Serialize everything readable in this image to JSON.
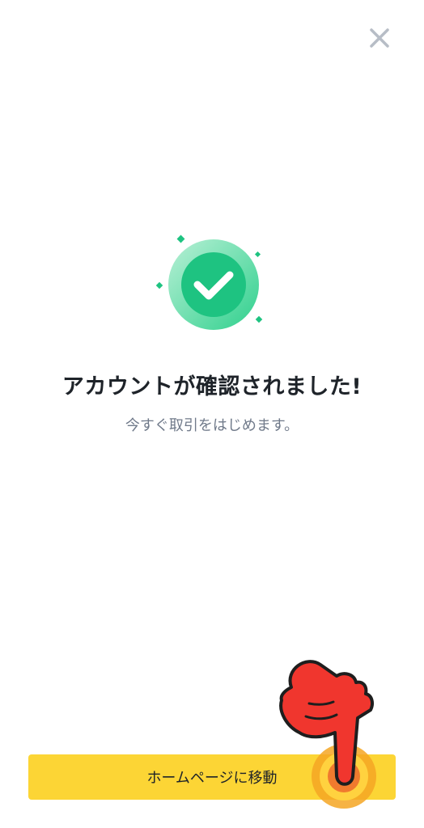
{
  "dialog": {
    "close_icon": "close-icon",
    "title": "アカウントが確認されました!",
    "subtitle": "今すぐ取引をはじめます。",
    "illustration_icon": "check-circle-icon"
  },
  "actions": {
    "primary_label": "ホームページに移動"
  },
  "overlay": {
    "pointer_icon": "pointing-hand-icon"
  },
  "colors": {
    "accent_yellow": "#fcd535",
    "success_green": "#1ec381",
    "text_primary": "#1e2329",
    "text_secondary": "#707a8a",
    "close_gray": "#b7bdc6",
    "pointer_red": "#f0362e"
  }
}
